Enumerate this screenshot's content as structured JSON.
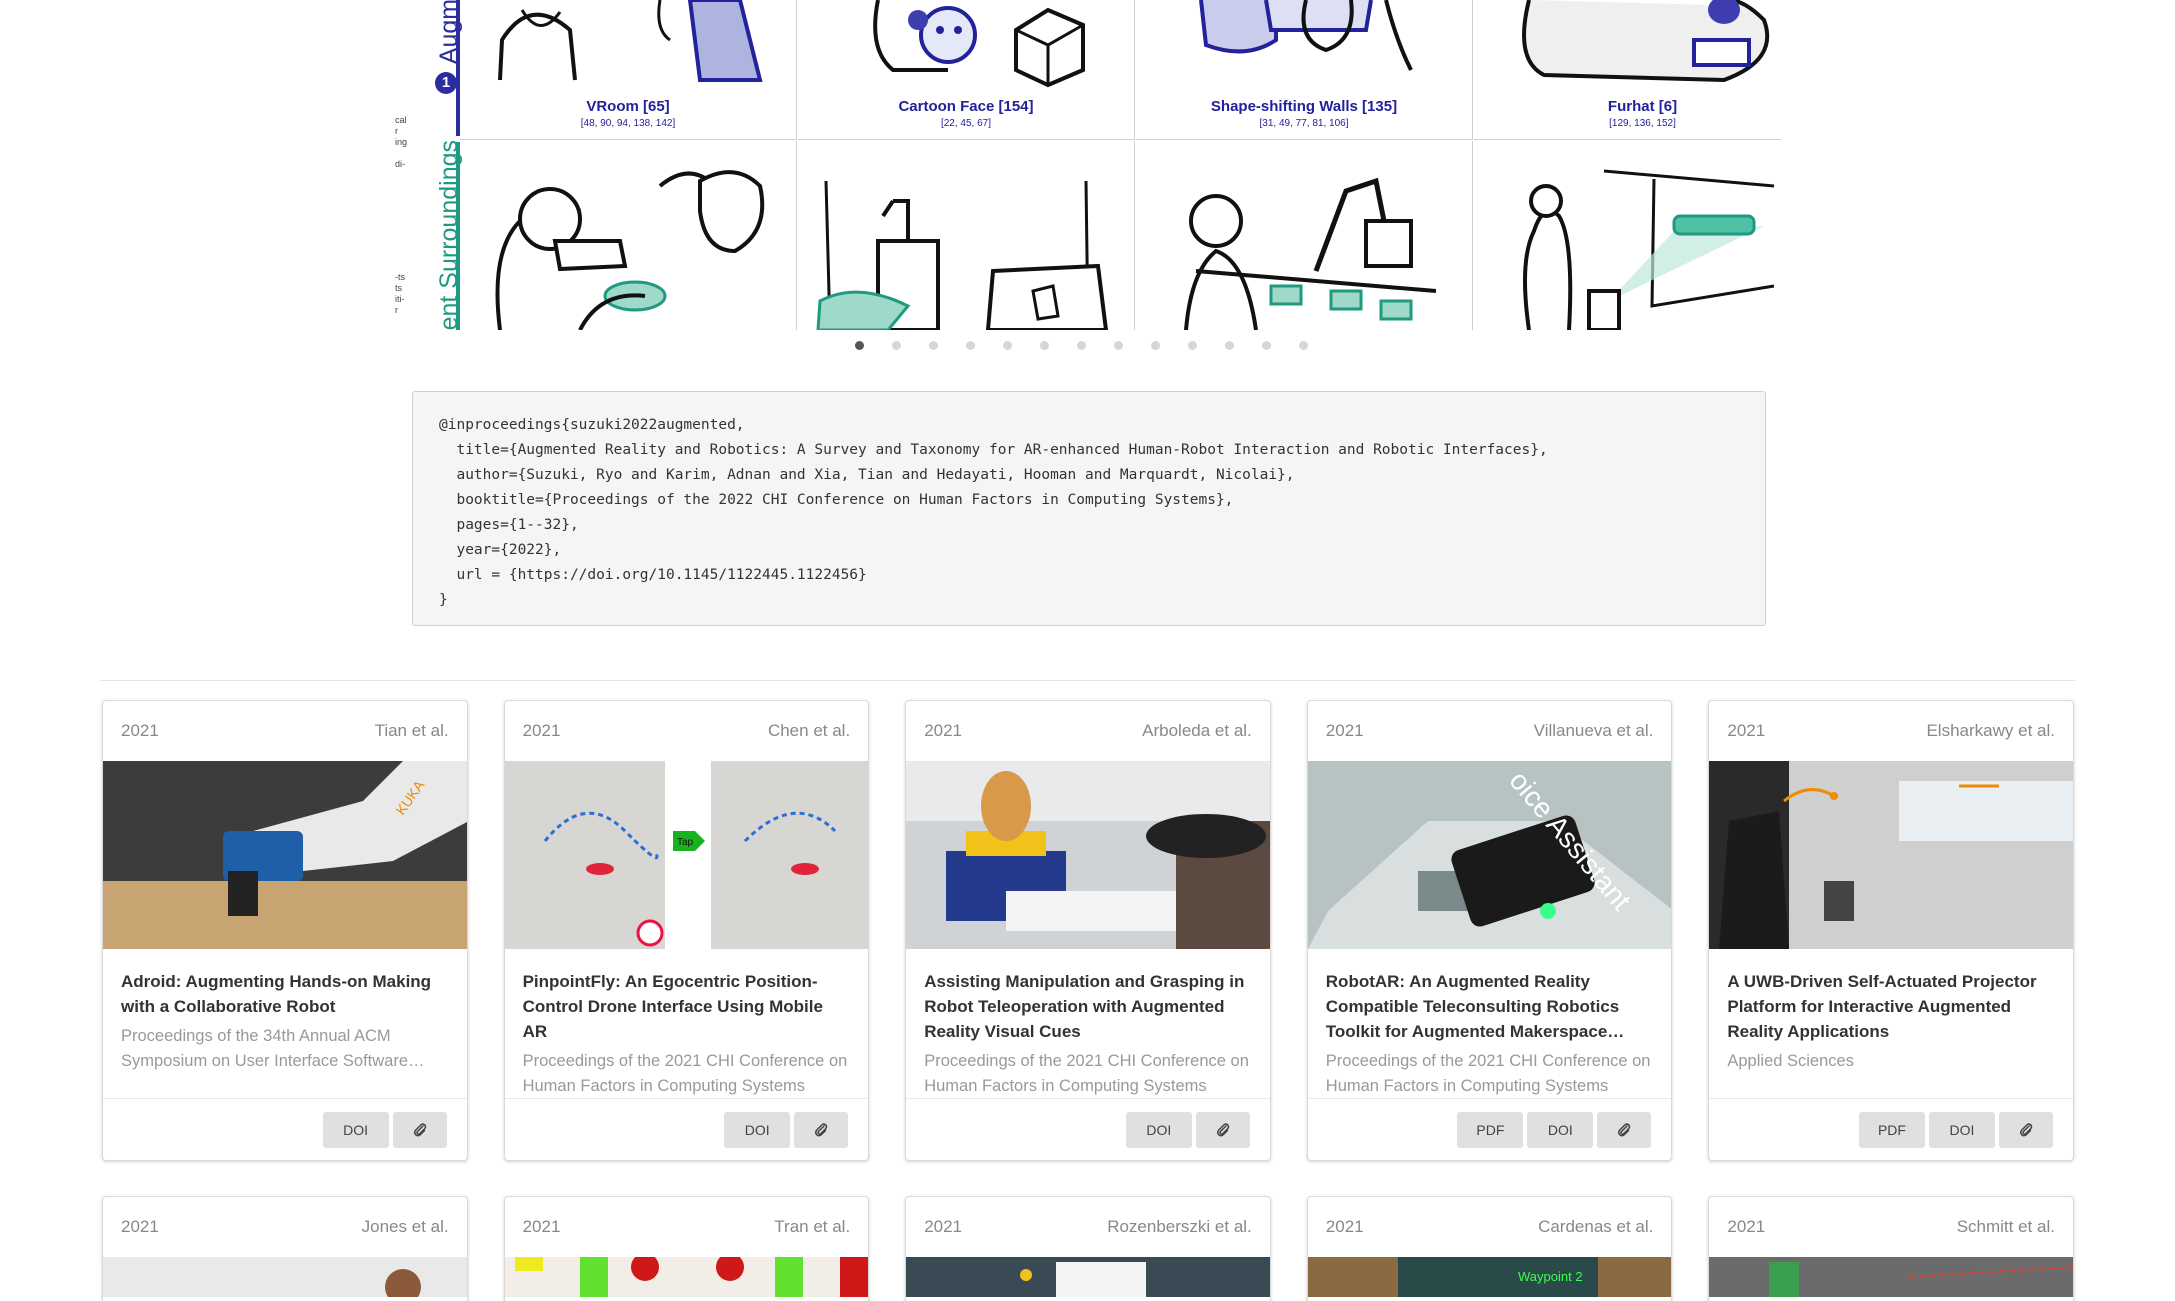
{
  "figure": {
    "row_labels": [
      "Augme",
      "ent Surroundings"
    ],
    "row1_number": "1",
    "side_fragments_top": [
      "cal",
      "r",
      "ing",
      "",
      "di-"
    ],
    "side_fragments_bottom": [
      "-ts",
      "ts",
      "iti-",
      "r"
    ],
    "cells_top": [
      {
        "title": "VRoom [65]",
        "refs": "[48, 90, 94, 138, 142]"
      },
      {
        "title": "Cartoon Face [154]",
        "refs": "[22, 45, 67]"
      },
      {
        "title": "Shape-shifting Walls [135]",
        "refs": "[31, 49, 77, 81, 106]"
      },
      {
        "title": "Furhat [6]",
        "refs": "[129, 136, 152]"
      }
    ]
  },
  "carousel": {
    "dot_count": 13,
    "active_index": 0
  },
  "bibtex": {
    "lines": [
      "@inproceedings{suzuki2022augmented,",
      "  title={Augmented Reality and Robotics: A Survey and Taxonomy for AR-enhanced Human-Robot Interaction and Robotic Interfaces},",
      "  author={Suzuki, Ryo and Karim, Adnan and Xia, Tian and Hedayati, Hooman and Marquardt, Nicolai},",
      "  booktitle={Proceedings of the 2022 CHI Conference on Human Factors in Computing Systems},",
      "  pages={1--32},",
      "  year={2022},",
      "  url = {https://doi.org/10.1145/1122445.1122456}",
      "}"
    ]
  },
  "cards_row1": [
    {
      "year": "2021",
      "authors": "Tian et al.",
      "title": "Adroid: Augmenting Hands-on Making with a Collaborative Robot",
      "venue": "Proceedings of the 34th Annual ACM Symposium on User Interface Software…",
      "buttons": [
        "DOI"
      ]
    },
    {
      "year": "2021",
      "authors": "Chen et al.",
      "title": "PinpointFly: An Egocentric Position-Control Drone Interface Using Mobile AR",
      "venue": "Proceedings of the 2021 CHI Conference on Human Factors in Computing Systems",
      "buttons": [
        "DOI"
      ]
    },
    {
      "year": "2021",
      "authors": "Arboleda et al.",
      "title": "Assisting Manipulation and Grasping in Robot Teleoperation with Augmented Reality Visual Cues",
      "venue": "Proceedings of the 2021 CHI Conference on Human Factors in Computing Systems",
      "buttons": [
        "DOI"
      ]
    },
    {
      "year": "2021",
      "authors": "Villanueva et al.",
      "title": "RobotAR: An Augmented Reality Compatible Teleconsulting Robotics Toolkit for Augmented Makerspace…",
      "venue": "Proceedings of the 2021 CHI Conference on Human Factors in Computing Systems",
      "buttons": [
        "PDF",
        "DOI"
      ]
    },
    {
      "year": "2021",
      "authors": "Elsharkawy et al.",
      "title": "A UWB-Driven Self-Actuated Projector Platform for Interactive Augmented Reality Applications",
      "venue": "Applied Sciences",
      "buttons": [
        "PDF",
        "DOI"
      ]
    }
  ],
  "cards_row2": [
    {
      "year": "2021",
      "authors": "Jones et al."
    },
    {
      "year": "2021",
      "authors": "Tran et al."
    },
    {
      "year": "2021",
      "authors": "Rozenberszki et al."
    },
    {
      "year": "2021",
      "authors": "Cardenas et al."
    },
    {
      "year": "2021",
      "authors": "Schmitt et al."
    }
  ],
  "image_overlay_text": {
    "kuka": "KUKA",
    "tap": "Tap",
    "voice": "oice Assistant",
    "waypoint": "Waypoint 2"
  },
  "icons": {
    "attach": "paperclip-icon"
  }
}
